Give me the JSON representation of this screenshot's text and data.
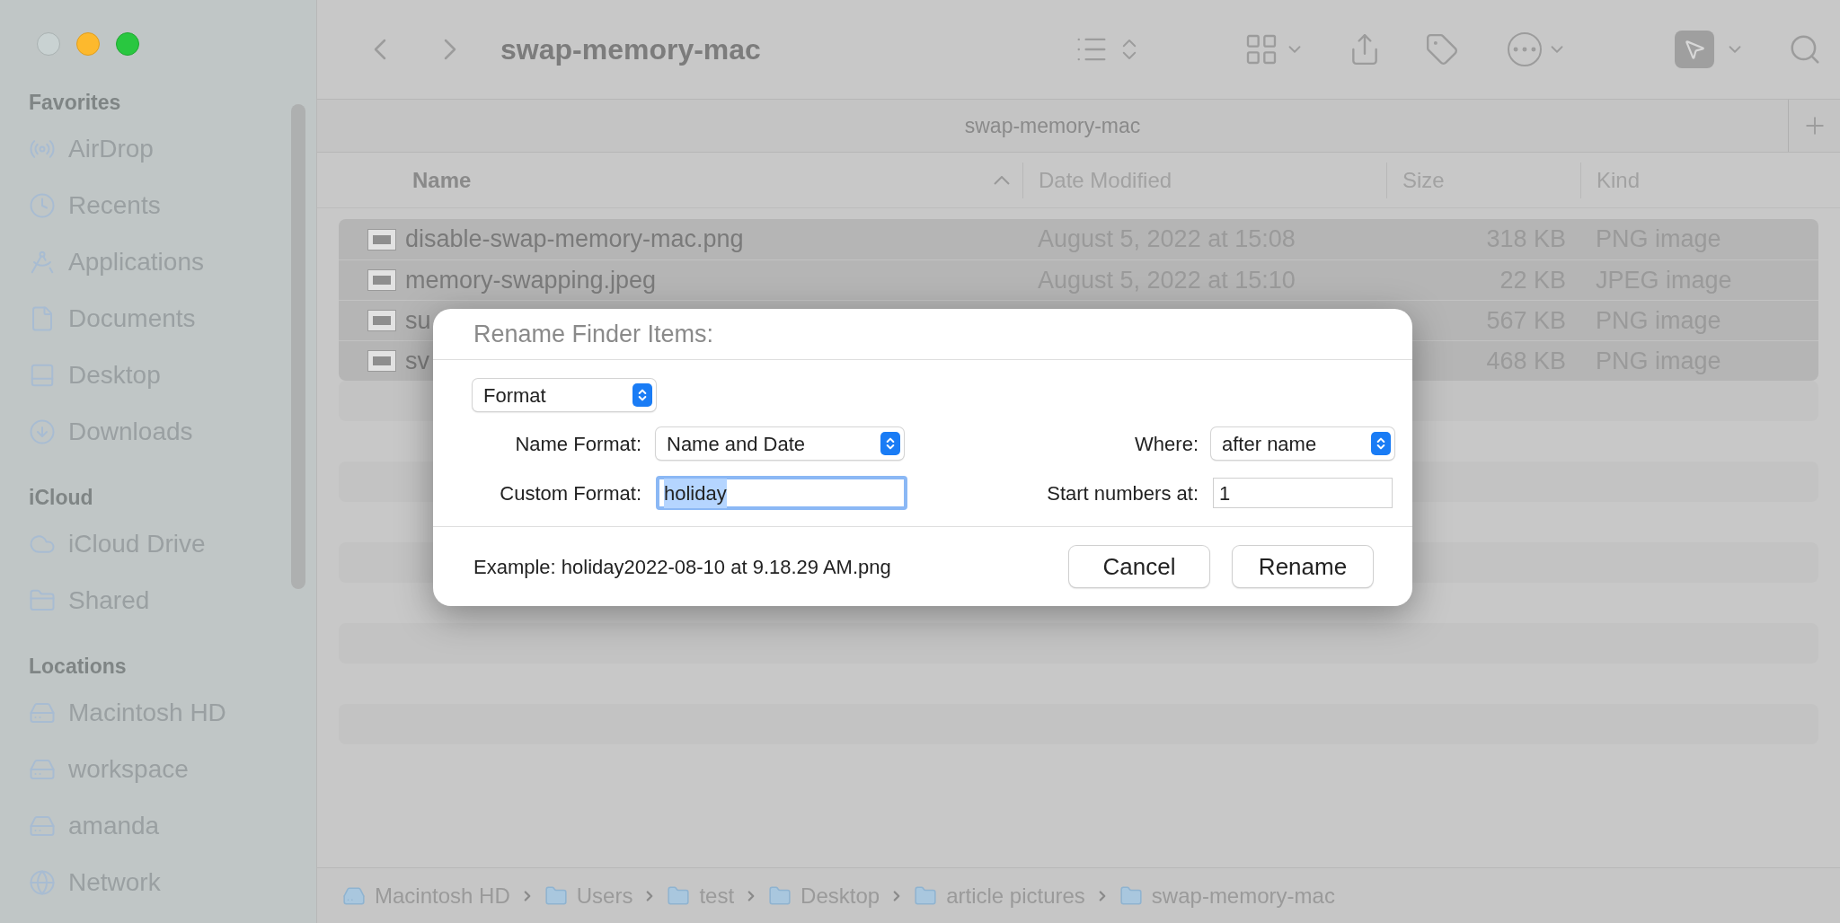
{
  "sidebar": {
    "sections": [
      {
        "title": "Favorites",
        "items": [
          {
            "label": "AirDrop",
            "kind": "airdrop"
          },
          {
            "label": "Recents",
            "kind": "recents"
          },
          {
            "label": "Applications",
            "kind": "applications"
          },
          {
            "label": "Documents",
            "kind": "documents"
          },
          {
            "label": "Desktop",
            "kind": "desktop"
          },
          {
            "label": "Downloads",
            "kind": "downloads"
          }
        ]
      },
      {
        "title": "iCloud",
        "items": [
          {
            "label": "iCloud Drive",
            "kind": "cloud"
          },
          {
            "label": "Shared",
            "kind": "shared"
          }
        ]
      },
      {
        "title": "Locations",
        "items": [
          {
            "label": "Macintosh HD",
            "kind": "disk"
          },
          {
            "label": "workspace",
            "kind": "server"
          },
          {
            "label": "amanda",
            "kind": "server"
          },
          {
            "label": "Network",
            "kind": "network"
          }
        ]
      }
    ]
  },
  "toolbar": {
    "title": "swap-memory-mac"
  },
  "tab": {
    "title": "swap-memory-mac"
  },
  "table": {
    "columns": [
      {
        "label": "Name",
        "sorted": true
      },
      {
        "label": "Date Modified",
        "sorted": false
      },
      {
        "label": "Size",
        "sorted": false
      },
      {
        "label": "Kind",
        "sorted": false
      }
    ],
    "rows": [
      {
        "name": "disable-swap-memory-mac.png",
        "date": "August 5, 2022 at 15:08",
        "size": "318 KB",
        "kind": "PNG image",
        "selected": true
      },
      {
        "name": "memory-swapping.jpeg",
        "date": "August 5, 2022 at 15:10",
        "size": "22 KB",
        "kind": "JPEG image",
        "selected": true
      },
      {
        "name": "su",
        "size": "567 KB",
        "kind": "PNG image",
        "selected": true
      },
      {
        "name": "sv",
        "size": "468 KB",
        "kind": "PNG image",
        "selected": true
      }
    ]
  },
  "dialog": {
    "title": "Rename Finder Items:",
    "mode": "Format",
    "name_format_label": "Name Format:",
    "name_format": "Name and Date",
    "where_label": "Where:",
    "where": "after name",
    "custom_format_label": "Custom Format:",
    "custom_format": "holiday",
    "custom_format_text_selected": true,
    "start_label": "Start numbers at:",
    "start": "1",
    "example": "Example: holiday2022-08-10 at 9.18.29 AM.png",
    "buttons": [
      "Cancel",
      "Rename"
    ]
  },
  "path_bar": {
    "items": [
      {
        "label": "Macintosh HD",
        "kind": "disk"
      },
      {
        "label": "Users",
        "kind": "folder"
      },
      {
        "label": "test",
        "kind": "folder"
      },
      {
        "label": "Desktop",
        "kind": "folder"
      },
      {
        "label": "article pictures",
        "kind": "folder"
      },
      {
        "label": "swap-memory-mac",
        "kind": "folder"
      }
    ]
  }
}
